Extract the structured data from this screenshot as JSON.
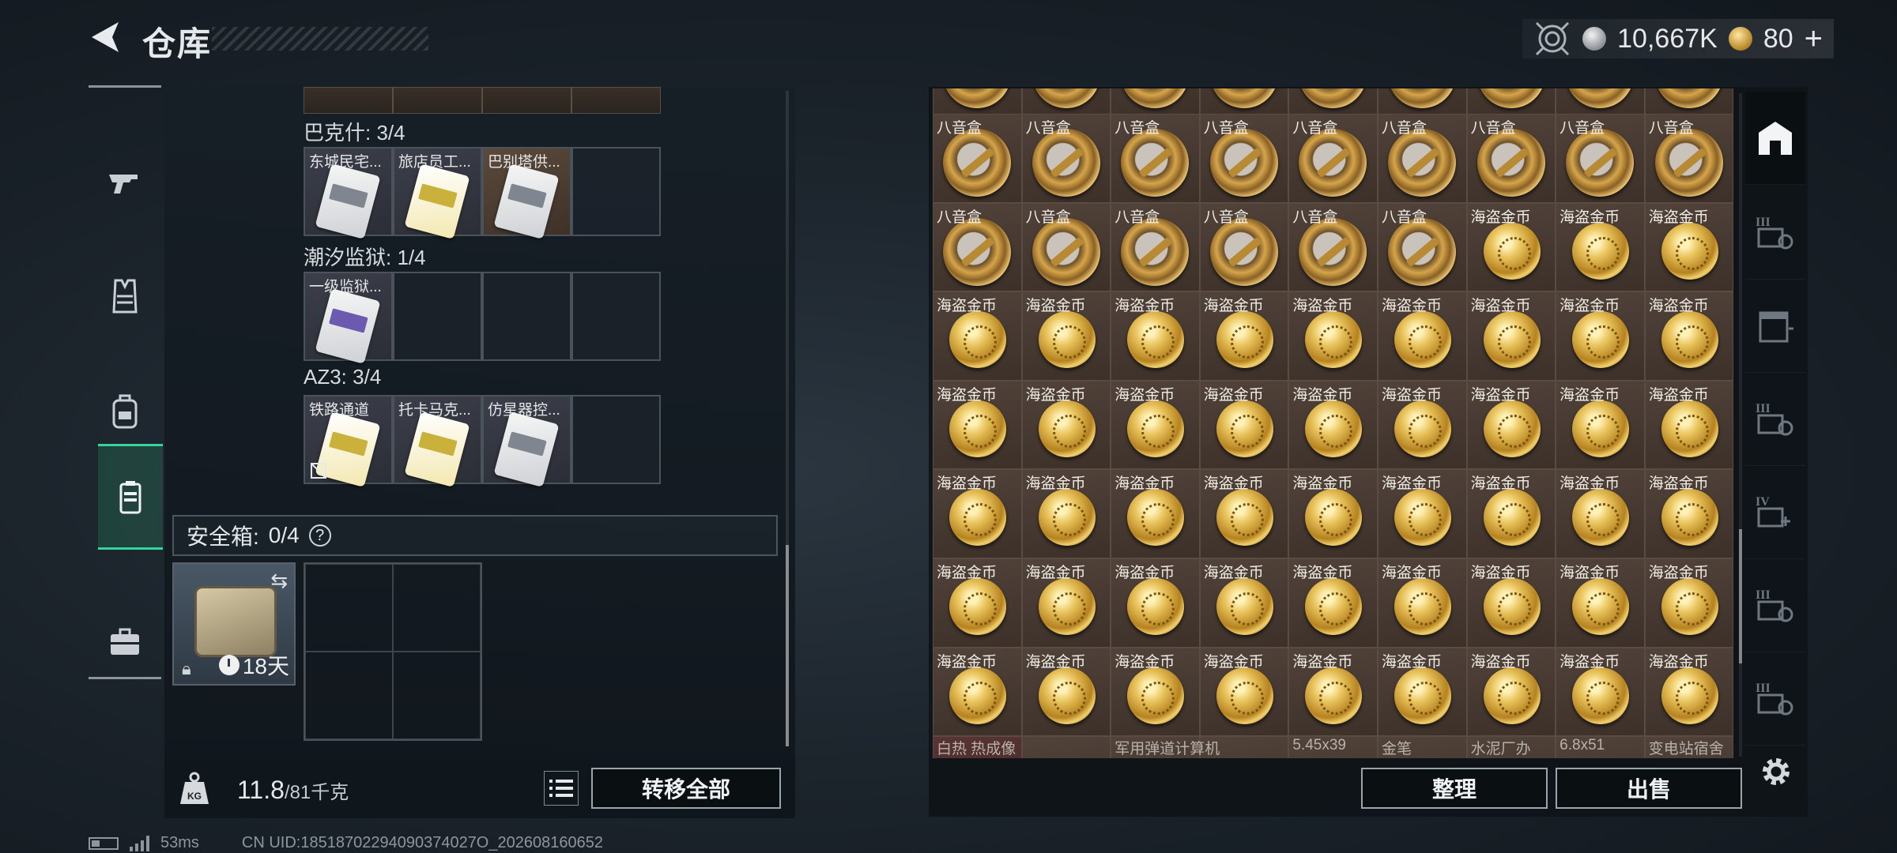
{
  "header": {
    "title": "仓库",
    "silver_amount": "10,667K",
    "gold_amount": "80",
    "gold_plus": "+"
  },
  "left_nav": {
    "items": [
      {
        "icon": "gun-icon"
      },
      {
        "icon": "armor-vest-icon"
      },
      {
        "icon": "backpack-icon"
      },
      {
        "icon": "keycard-case-icon",
        "active": true
      },
      {
        "icon": "briefcase-icon"
      }
    ]
  },
  "keycard_groups": [
    {
      "label": "巴克什: 3/4",
      "cards": [
        "东城民宅...",
        "旅店员工...",
        "巴别塔供..."
      ],
      "card_styles": [
        "white",
        "white",
        "orange"
      ]
    },
    {
      "label": "潮汐监狱: 1/4",
      "cards": [
        "一级监狱..."
      ],
      "card_styles": [
        "purple"
      ]
    },
    {
      "label": "AZ3: 3/4",
      "cards": [
        "铁路通道",
        "托卡马克...",
        "仿星器控..."
      ],
      "card_styles": [
        "yellow",
        "yellow",
        "white"
      ]
    }
  ],
  "safe_box": {
    "label": "安全箱:",
    "count": "0/4",
    "help": "?",
    "days_left": "18天"
  },
  "capacity": {
    "current": "11.8",
    "max": "/81千克"
  },
  "buttons": {
    "transfer_all": "转移全部",
    "sort": "整理",
    "sell": "出售"
  },
  "stash": {
    "musicbox_name": "八音盒",
    "coin_name": "海盗金币",
    "rows": [
      [
        "八音盒",
        "八音盒",
        "八音盒",
        "八音盒",
        "八音盒",
        "八音盒",
        "八音盒",
        "八音盒",
        "八音盒"
      ],
      [
        "八音盒",
        "八音盒",
        "八音盒",
        "八音盒",
        "八音盒",
        "八音盒",
        "海盗金币",
        "海盗金币",
        "海盗金币"
      ],
      [
        "海盗金币",
        "海盗金币",
        "海盗金币",
        "海盗金币",
        "海盗金币",
        "海盗金币",
        "海盗金币",
        "海盗金币",
        "海盗金币"
      ],
      [
        "海盗金币",
        "海盗金币",
        "海盗金币",
        "海盗金币",
        "海盗金币",
        "海盗金币",
        "海盗金币",
        "海盗金币",
        "海盗金币"
      ],
      [
        "海盗金币",
        "海盗金币",
        "海盗金币",
        "海盗金币",
        "海盗金币",
        "海盗金币",
        "海盗金币",
        "海盗金币",
        "海盗金币"
      ],
      [
        "海盗金币",
        "海盗金币",
        "海盗金币",
        "海盗金币",
        "海盗金币",
        "海盗金币",
        "海盗金币",
        "海盗金币",
        "海盗金币"
      ],
      [
        "海盗金币",
        "海盗金币",
        "海盗金币",
        "海盗金币",
        "海盗金币",
        "海盗金币",
        "海盗金币",
        "海盗金币",
        "海盗金币"
      ]
    ],
    "partial_row": [
      "白热 热成像",
      "",
      "军用弹道计算机",
      "",
      "5.45x39",
      "金笔",
      "水泥厂办",
      "6.8x51",
      "变电站宿舍"
    ]
  },
  "right_nav": {
    "items": [
      {
        "icon": "stash-home-icon",
        "active": true
      },
      {
        "icon": "expansion-case-iii-icon",
        "tier": "III"
      },
      {
        "icon": "storage-cabinet-icon"
      },
      {
        "icon": "expansion-case-iii-icon",
        "tier": "III"
      },
      {
        "icon": "medical-case-iv-icon",
        "tier": "IV"
      },
      {
        "icon": "expansion-case-iii-icon",
        "tier": "III"
      },
      {
        "icon": "expansion-case-iii-icon",
        "tier": "III"
      }
    ]
  },
  "status_bar": {
    "ping": "53ms",
    "uid": "CN UID:18518702294090374027O_202608160652"
  }
}
